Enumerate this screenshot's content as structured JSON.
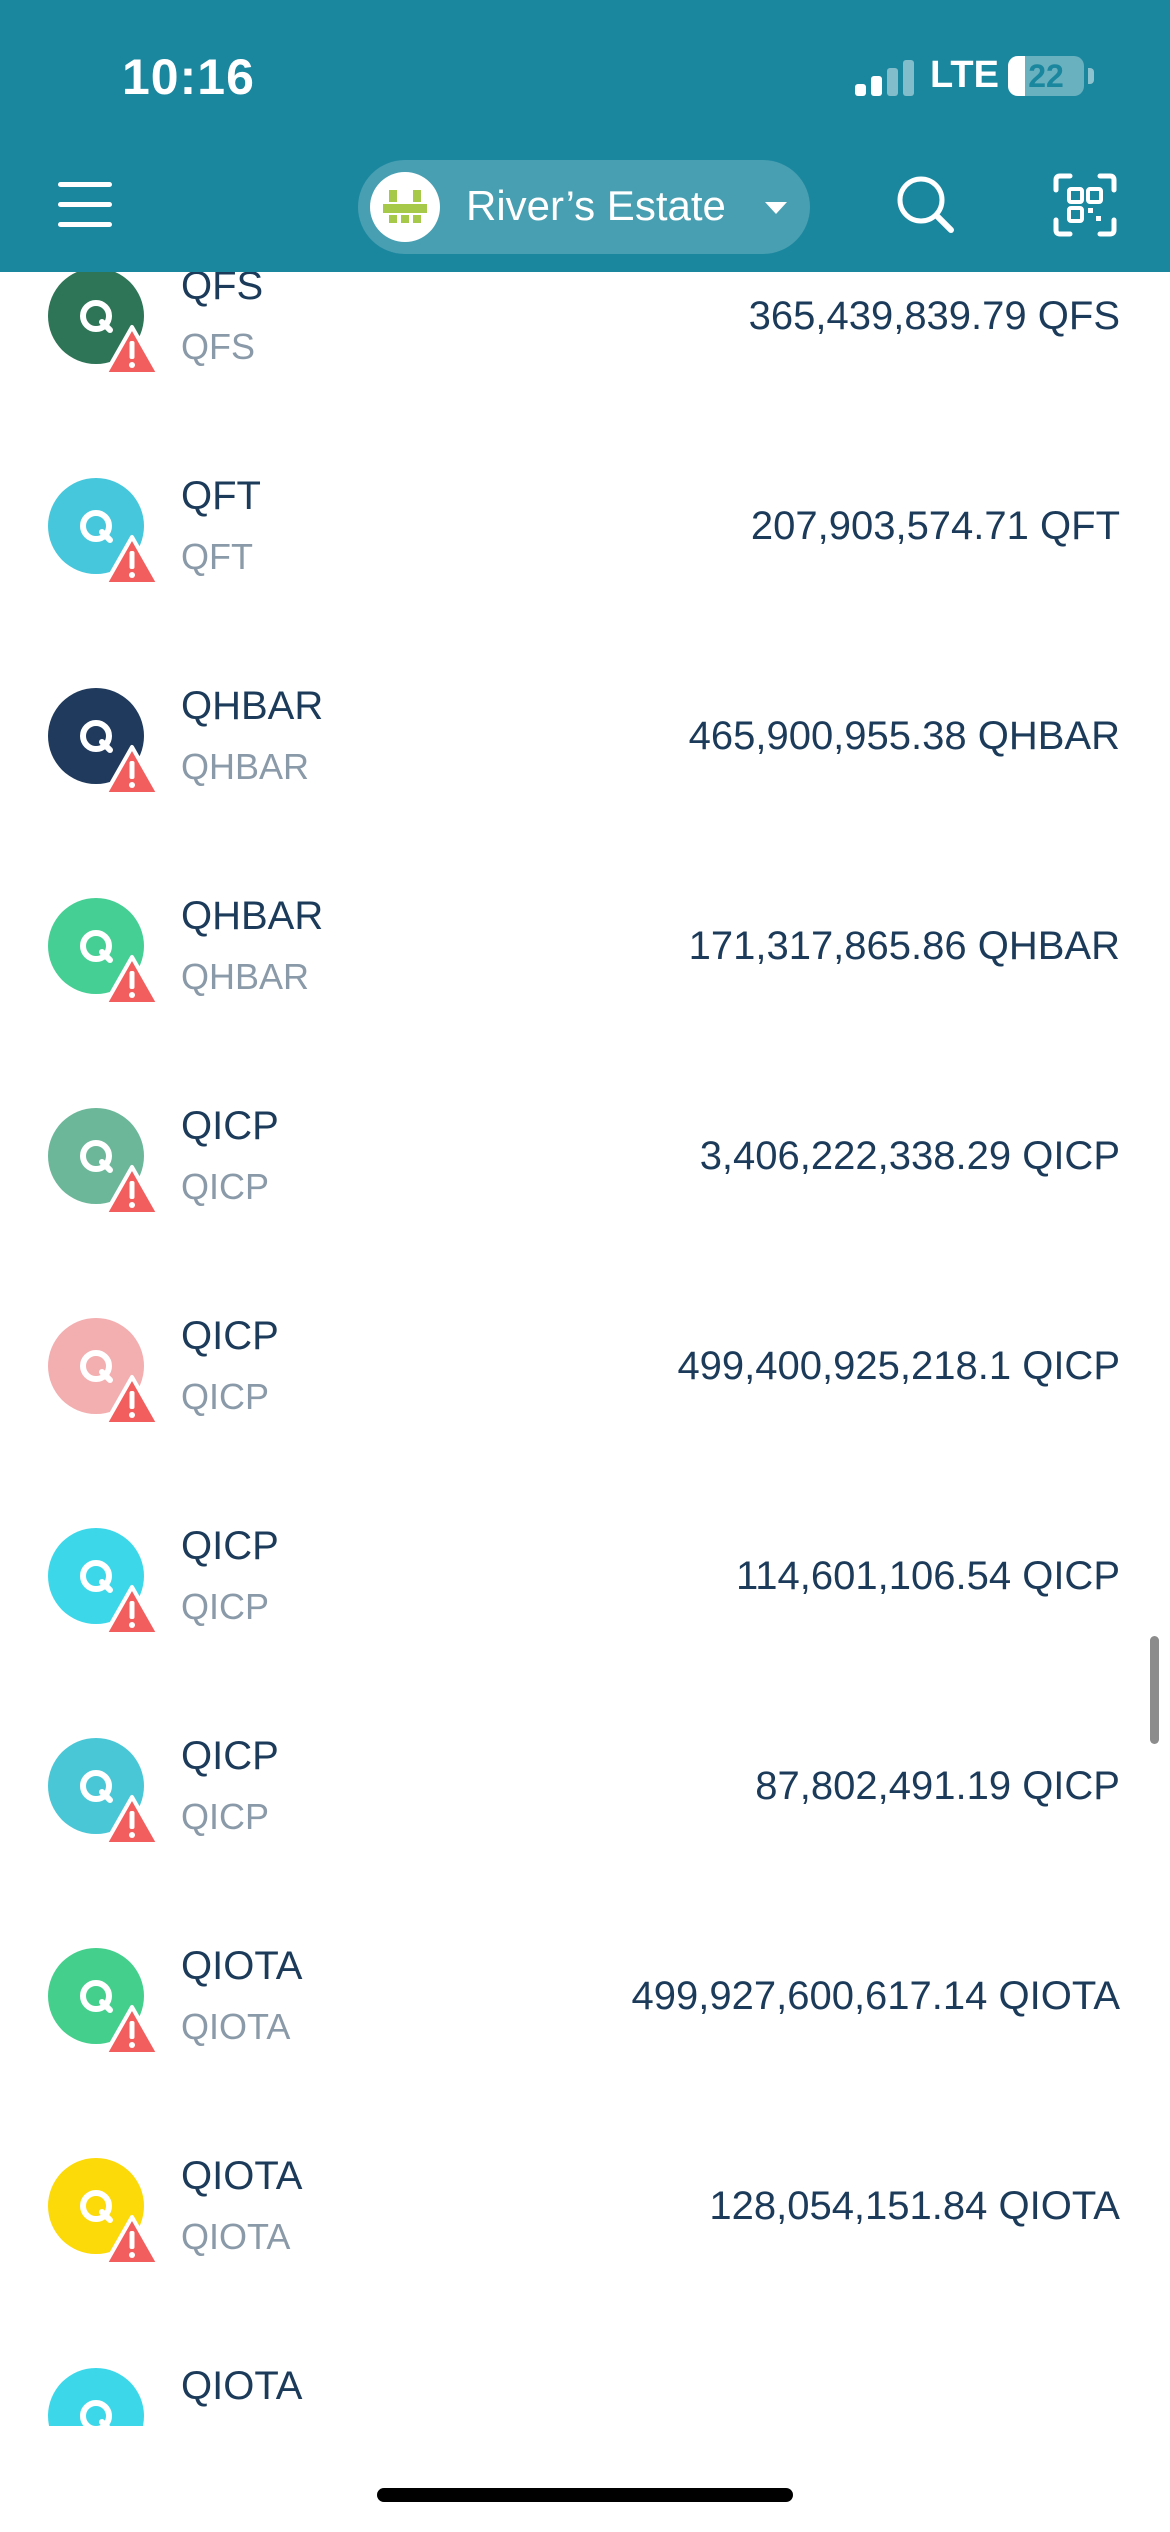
{
  "status_bar": {
    "time": "10:16",
    "network": "LTE",
    "battery": "22",
    "battery_level": 0.22
  },
  "header": {
    "estate_name": "River’s Estate",
    "menu_icon": "hamburger-menu-icon",
    "search_icon": "search-icon",
    "scan_icon": "qr-scan-icon",
    "background_color": "#1b879f"
  },
  "tokens": [
    {
      "name": "QFS",
      "symbol": "QFS",
      "balance": "365,439,839.79 QFS",
      "color": "#2e7456",
      "warning": true
    },
    {
      "name": "QFT",
      "symbol": "QFT",
      "balance": "207,903,574.71 QFT",
      "color": "#46c7dc",
      "warning": true
    },
    {
      "name": "QHBAR",
      "symbol": "QHBAR",
      "balance": "465,900,955.38 QHBAR",
      "color": "#1f3a5c",
      "warning": true
    },
    {
      "name": "QHBAR",
      "symbol": "QHBAR",
      "balance": "171,317,865.86 QHBAR",
      "color": "#46cf94",
      "warning": true
    },
    {
      "name": "QICP",
      "symbol": "QICP",
      "balance": "3,406,222,338.29 QICP",
      "color": "#6cb79a",
      "warning": true
    },
    {
      "name": "QICP",
      "symbol": "QICP",
      "balance": "499,400,925,218.1 QICP",
      "color": "#f3aeb0",
      "warning": true
    },
    {
      "name": "QICP",
      "symbol": "QICP",
      "balance": "114,601,106.54 QICP",
      "color": "#3cd8ea",
      "warning": true
    },
    {
      "name": "QICP",
      "symbol": "QICP",
      "balance": "87,802,491.19 QICP",
      "color": "#4ac7d6",
      "warning": true
    },
    {
      "name": "QIOTA",
      "symbol": "QIOTA",
      "balance": "499,927,600,617.14 QIOTA",
      "color": "#44cf8c",
      "warning": true
    },
    {
      "name": "QIOTA",
      "symbol": "QIOTA",
      "balance": "128,054,151.84 QIOTA",
      "color": "#fcd908",
      "warning": true
    },
    {
      "name": "QIOTA",
      "symbol": "",
      "balance": "",
      "color": "#3cd8ea",
      "warning": false
    }
  ],
  "colors": {
    "text_primary": "#1c3b5a",
    "text_secondary": "#8b9aa8",
    "warning": "#f25d5d"
  }
}
